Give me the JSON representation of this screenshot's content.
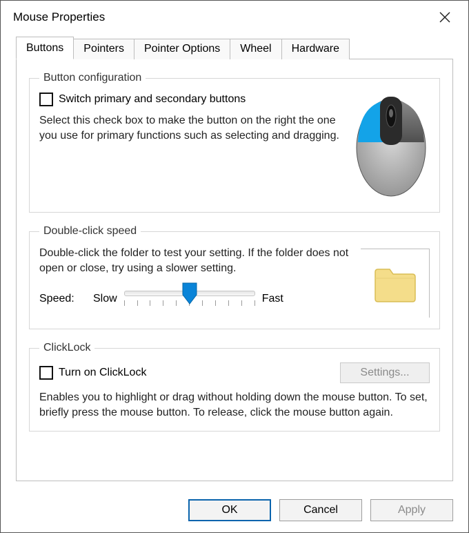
{
  "window": {
    "title": "Mouse Properties"
  },
  "tabs": [
    "Buttons",
    "Pointers",
    "Pointer Options",
    "Wheel",
    "Hardware"
  ],
  "active_tab_index": 0,
  "button_config": {
    "legend": "Button configuration",
    "switch_label": "Switch primary and secondary buttons",
    "switch_checked": false,
    "description": "Select this check box to make the button on the right the one you use for primary functions such as selecting and dragging."
  },
  "double_click": {
    "legend": "Double-click speed",
    "description": "Double-click the folder to test your setting. If the folder does not open or close, try using a slower setting.",
    "speed_label": "Speed:",
    "slow_label": "Slow",
    "fast_label": "Fast",
    "slider_value": 5,
    "slider_min": 0,
    "slider_max": 10
  },
  "clicklock": {
    "legend": "ClickLock",
    "turn_on_label": "Turn on ClickLock",
    "turn_on_checked": false,
    "settings_label": "Settings...",
    "settings_enabled": false,
    "description": "Enables you to highlight or drag without holding down the mouse button. To set, briefly press the mouse button. To release, click the mouse button again."
  },
  "buttons": {
    "ok": "OK",
    "cancel": "Cancel",
    "apply": "Apply",
    "apply_enabled": false
  },
  "colors": {
    "accent": "#0a84d8",
    "mouse_body": "#b9b9b9",
    "mouse_left_button": "#13a3e8",
    "mouse_dark": "#6e6e6e",
    "folder": "#f4dd8a",
    "folder_edge": "#d9bd55"
  }
}
